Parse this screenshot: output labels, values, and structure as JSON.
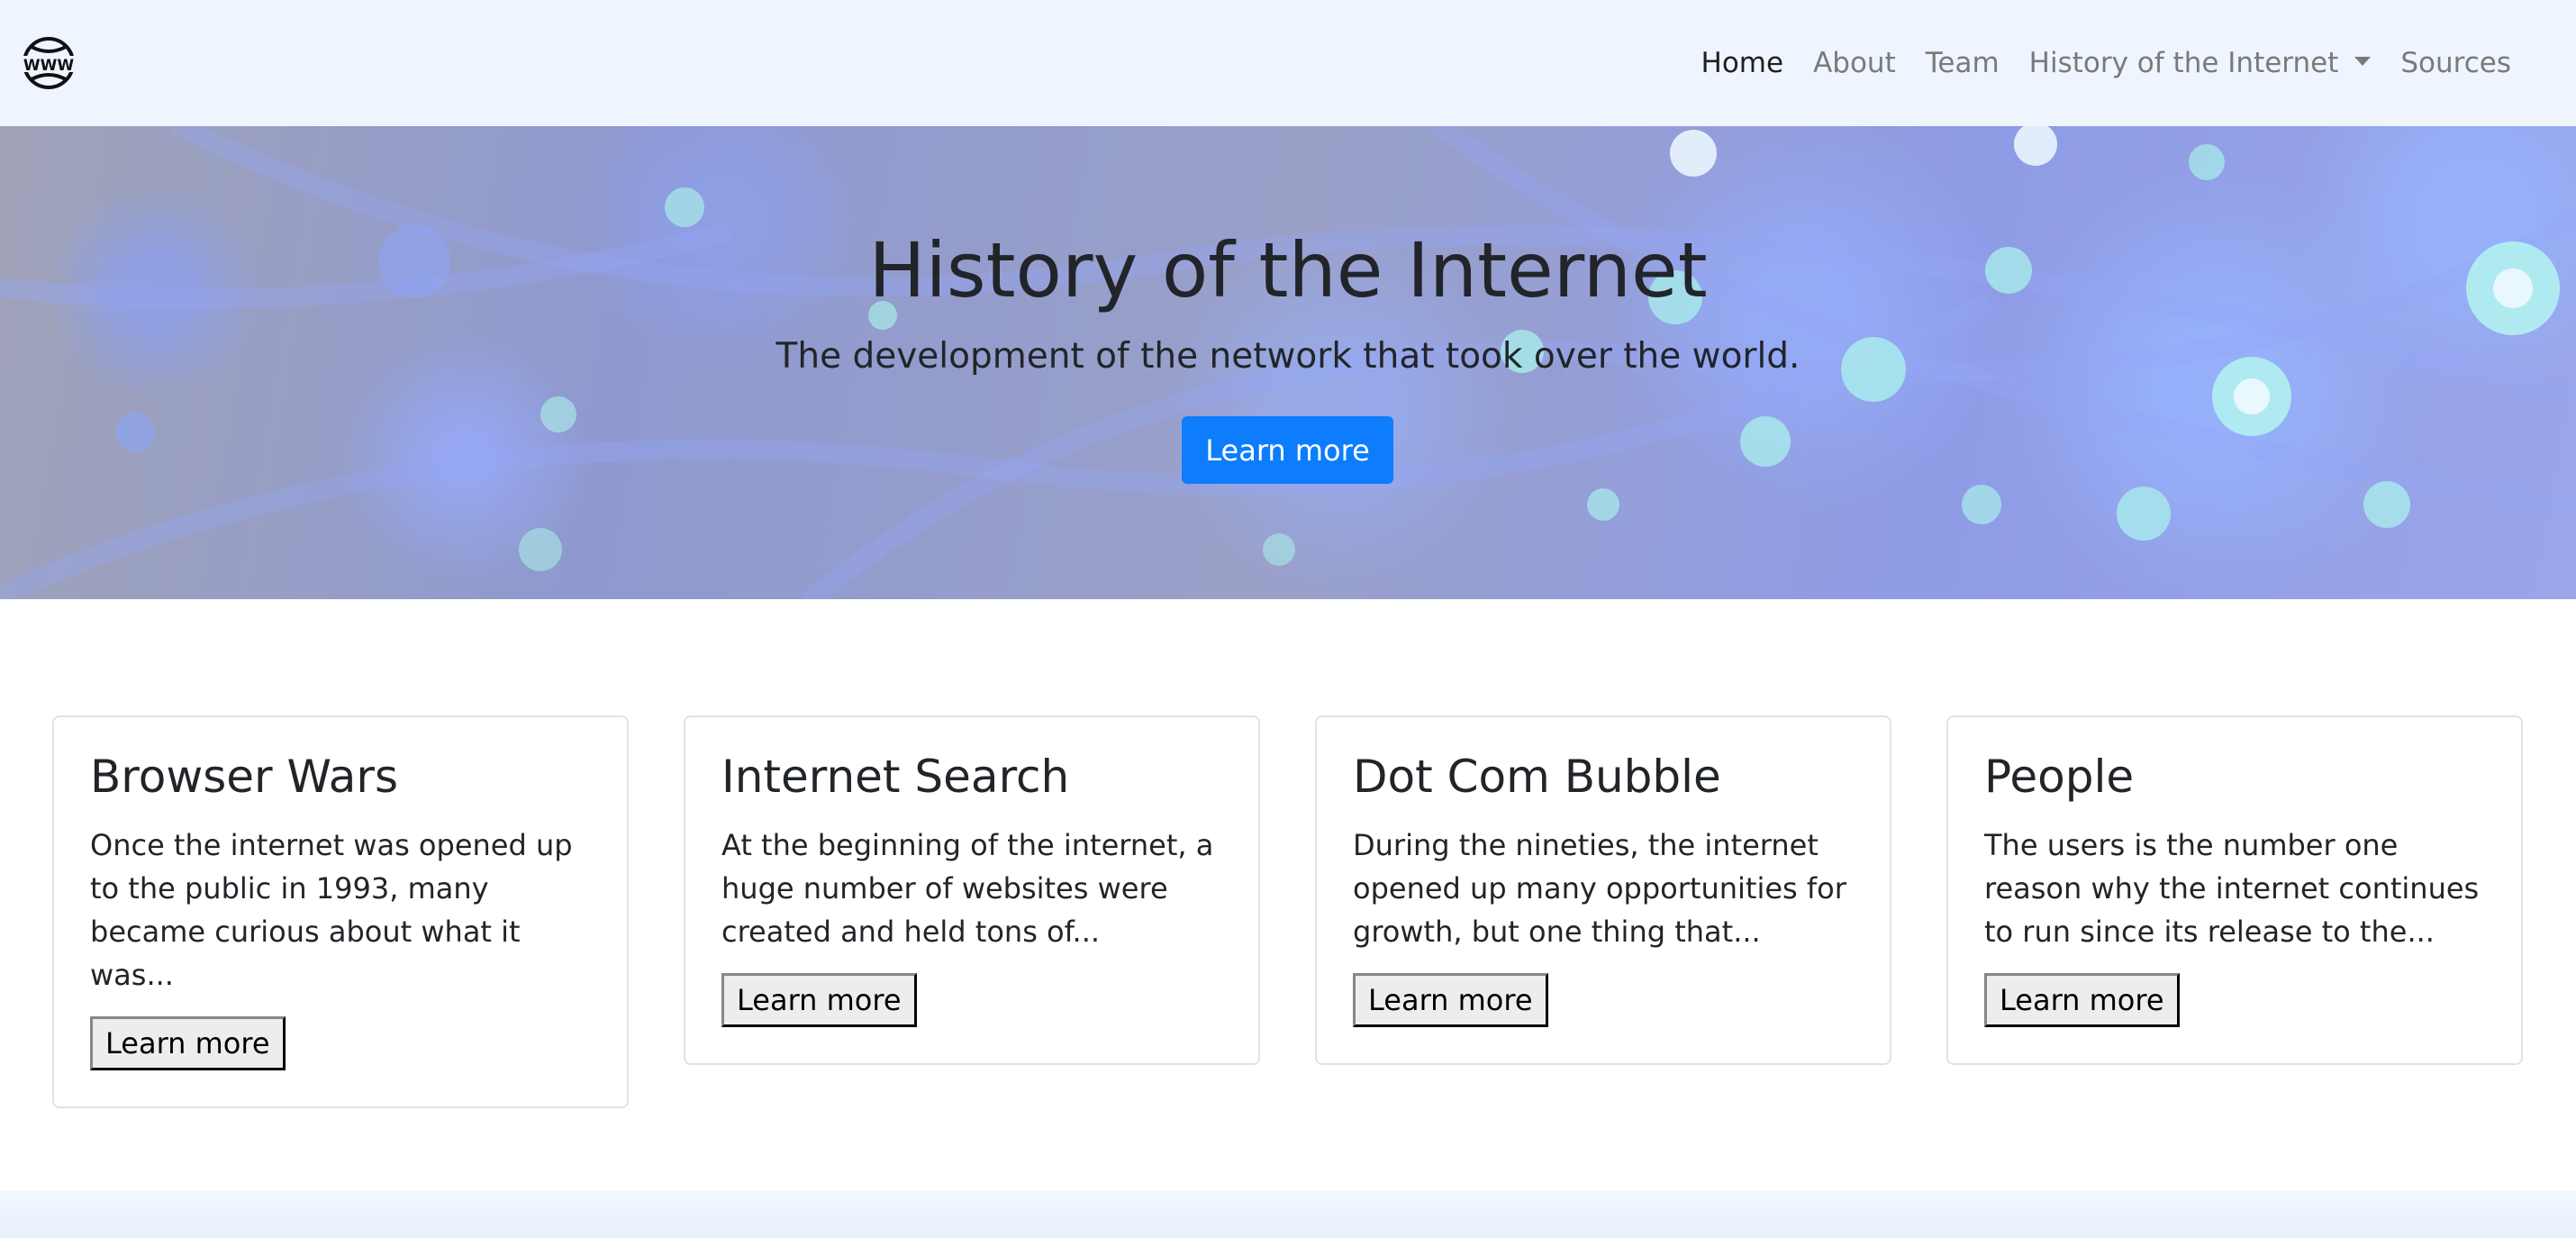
{
  "nav": {
    "logo_text": "WWW",
    "links": [
      {
        "label": "Home"
      },
      {
        "label": "About"
      },
      {
        "label": "Team"
      },
      {
        "label": "History of the Internet"
      },
      {
        "label": "Sources"
      }
    ]
  },
  "hero": {
    "title": "History of the Internet",
    "subtitle": "The development of the network that took over the world.",
    "button_label": "Learn more"
  },
  "cards": [
    {
      "title": "Browser Wars",
      "text": "Once the internet was opened up to the public in 1993, many became curious about what it was...",
      "button_label": "Learn more"
    },
    {
      "title": "Internet Search",
      "text": "At the beginning of the internet, a huge number of websites were created and held tons of...",
      "button_label": "Learn more"
    },
    {
      "title": "Dot Com Bubble",
      "text": "During the nineties, the internet opened up many opportunities for growth, but one thing that...",
      "button_label": "Learn more"
    },
    {
      "title": "People",
      "text": "The users is the number one reason why the internet continues to run since its release to the...",
      "button_label": "Learn more"
    }
  ],
  "colors": {
    "navbar_bg": "#eef5ff",
    "primary_button": "#0d7dfd"
  }
}
